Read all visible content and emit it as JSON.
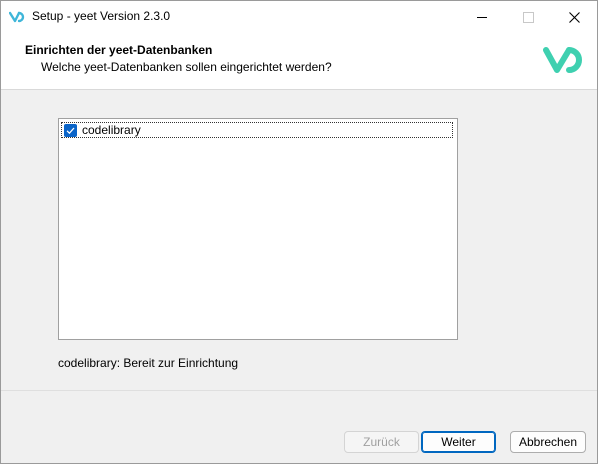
{
  "window": {
    "title": "Setup - yeet Version 2.3.0",
    "app_icon": "yeet-logo-icon",
    "controls": [
      "minimize-icon",
      "maximize-icon",
      "close-icon"
    ]
  },
  "header": {
    "title": "Einrichten der yeet-Datenbanken",
    "subtitle": "Welche yeet-Datenbanken sollen eingerichtet werden?",
    "logo": "yeet-brand-logo"
  },
  "database_list": {
    "items": [
      {
        "label": "codelibrary",
        "checked": true
      }
    ]
  },
  "status": {
    "text": "codelibrary: Bereit zur Einrichtung"
  },
  "buttons": {
    "back": {
      "label": "Zurück",
      "enabled": false
    },
    "next": {
      "label": "Weiter",
      "enabled": true
    },
    "cancel": {
      "label": "Abbrechen",
      "enabled": true
    }
  },
  "colors": {
    "accent": "#0a64c8",
    "brand": "#3fd0b0"
  }
}
